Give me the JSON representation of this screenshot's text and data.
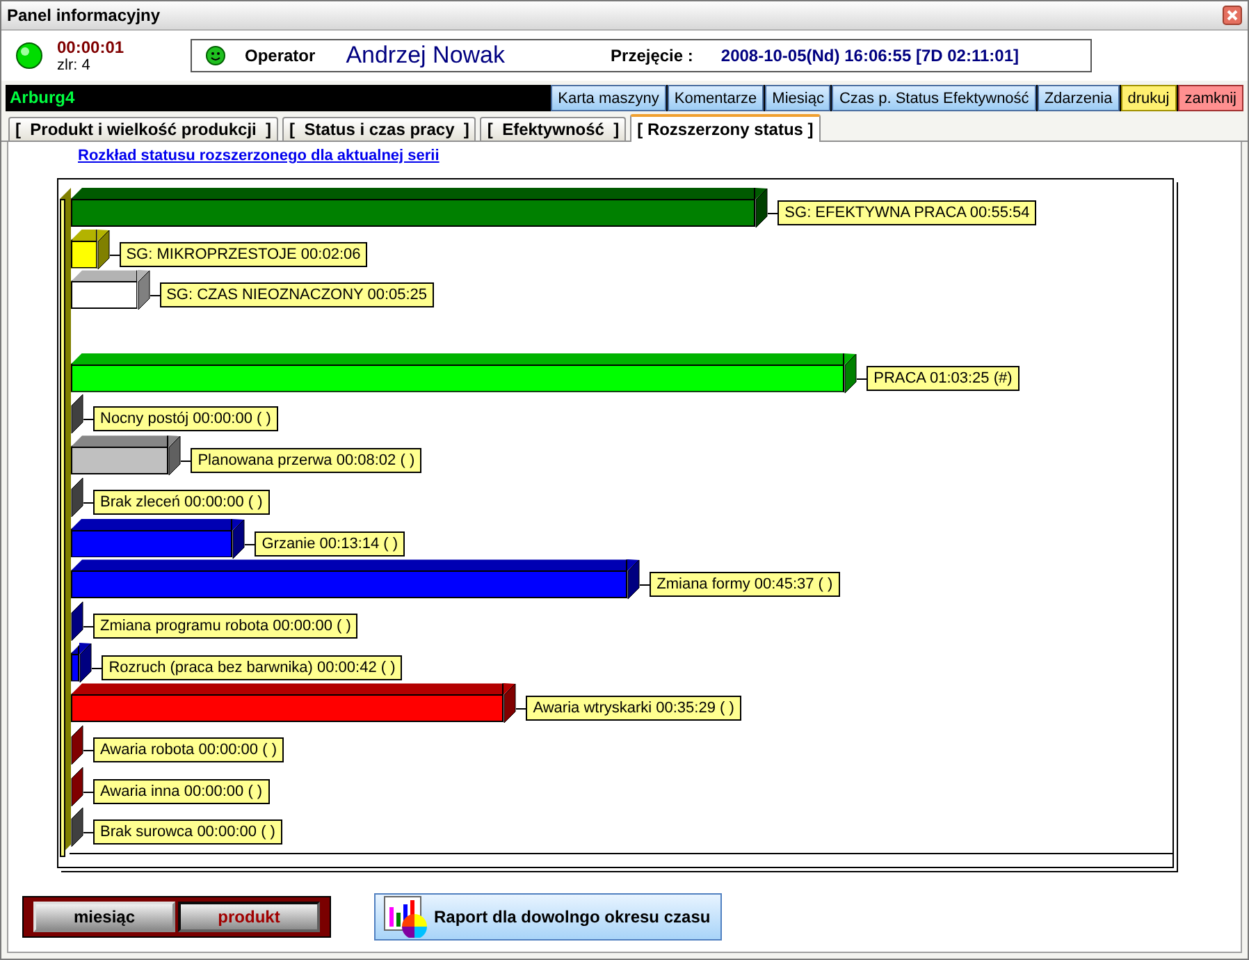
{
  "window": {
    "title": "Panel informacyjny"
  },
  "header": {
    "timer": "00:00:01",
    "counter": "zlr: 4",
    "operator_label": "Operator",
    "operator_name": "Andrzej Nowak",
    "takeover_label": "Przejęcie :",
    "takeover_value": "2008-10-05(Nd) 16:06:55 [7D 02:11:01]"
  },
  "toolbar": {
    "machine": "Arburg4",
    "buttons": [
      {
        "label": "Karta maszyny",
        "kind": "nav"
      },
      {
        "label": "Komentarze",
        "kind": "nav"
      },
      {
        "label": "Miesiąc",
        "kind": "nav"
      },
      {
        "label": "Czas p. Status Efektywność",
        "kind": "nav"
      },
      {
        "label": "Zdarzenia",
        "kind": "nav"
      },
      {
        "label": "drukuj",
        "kind": "print"
      },
      {
        "label": "zamknij",
        "kind": "close"
      }
    ]
  },
  "tabs": [
    {
      "label": "[  Produkt i wielkość produkcji  ]",
      "selected": false
    },
    {
      "label": "[  Status i czas pracy  ]",
      "selected": false
    },
    {
      "label": "[  Efektywność  ]",
      "selected": false
    },
    {
      "label": "[ Rozszerzony status ]",
      "selected": true
    }
  ],
  "chart": {
    "title": "Rozkład statusu rozszerzonego dla aktualnej serii",
    "bars": [
      {
        "label": "SG: EFEKTYWNA PRACA 00:55:54",
        "color": "#008000",
        "level": 0.631,
        "gap_before": false
      },
      {
        "label": "SG: MIKROPRZESTOJE 00:02:06",
        "color": "#ffff00",
        "level": 0.024,
        "gap_before": false
      },
      {
        "label": "SG: CZAS NIEOZNACZONY 00:05:25",
        "color": "#ffffff",
        "level": 0.061,
        "gap_before": false
      },
      {
        "label": "PRACA 01:03:25 (#)",
        "color": "#00ff00",
        "level": 0.713,
        "gap_before": true
      },
      {
        "label": "Nocny postój 00:00:00 ( )",
        "color": "#404040",
        "level": 0,
        "gap_before": false
      },
      {
        "label": "Planowana przerwa 00:08:02 ( )",
        "color": "#c0c0c0",
        "level": 0.09,
        "gap_before": false
      },
      {
        "label": "Brak zleceń 00:00:00 ( )",
        "color": "#404040",
        "level": 0,
        "gap_before": false
      },
      {
        "label": "Grzanie 00:13:14 ( )",
        "color": "#0000ff",
        "level": 0.149,
        "gap_before": false
      },
      {
        "label": "Zmiana formy 00:45:37 ( )",
        "color": "#0000ff",
        "level": 0.513,
        "gap_before": false
      },
      {
        "label": "Zmiana programu robota 00:00:00 ( )",
        "color": "#000080",
        "level": 0,
        "gap_before": false
      },
      {
        "label": "Rozruch (praca bez barwnika) 00:00:42 ( )",
        "color": "#0000ff",
        "level": 0.008,
        "gap_before": false
      },
      {
        "label": "Awaria wtryskarki 00:35:29 ( )",
        "color": "#ff0000",
        "level": 0.399,
        "gap_before": false
      },
      {
        "label": "Awaria robota 00:00:00 ( )",
        "color": "#800000",
        "level": 0,
        "gap_before": false
      },
      {
        "label": "Awaria inna 00:00:00 ( )",
        "color": "#800000",
        "level": 0,
        "gap_before": false
      },
      {
        "label": "Brak surowca 00:00:00 ( )",
        "color": "#404040",
        "level": 0,
        "gap_before": false
      }
    ]
  },
  "footer": {
    "toggle": [
      {
        "label": "miesiąc",
        "selected": false
      },
      {
        "label": "produkt",
        "selected": true
      }
    ],
    "report_button": "Raport dla dowolngo okresu czasu"
  }
}
